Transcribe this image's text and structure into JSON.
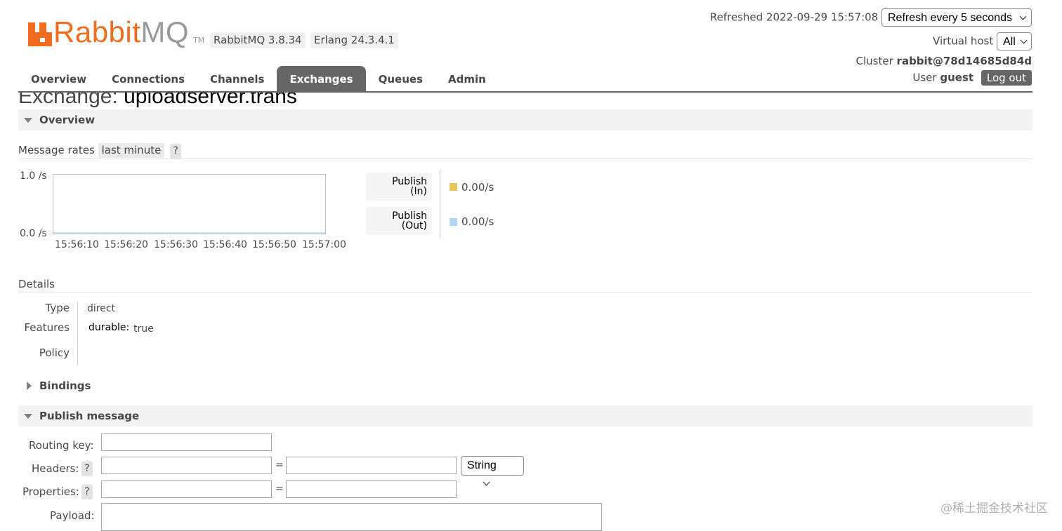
{
  "header": {
    "logo_main": "Rabbit",
    "logo_accent": "MQ",
    "logo_tm": "TM",
    "rabbitmq_version": "RabbitMQ 3.8.34",
    "erlang_version": "Erlang 24.3.4.1",
    "refreshed_label": "Refreshed 2022-09-29 15:57:08",
    "refresh_select": "Refresh every 5 seconds",
    "vhost_label": "Virtual host",
    "vhost_value": "All",
    "cluster_label": "Cluster",
    "cluster_name": "rabbit@78d14685d84d",
    "user_label": "User",
    "user_name": "guest",
    "logout": "Log out"
  },
  "tabs": [
    {
      "label": "Overview"
    },
    {
      "label": "Connections"
    },
    {
      "label": "Channels"
    },
    {
      "label": "Exchanges",
      "active": true
    },
    {
      "label": "Queues"
    },
    {
      "label": "Admin"
    }
  ],
  "page": {
    "title_prefix": "Exchange:",
    "title_name": "uploadserver.trans"
  },
  "overview": {
    "section_label": "Overview",
    "rates_label": "Message rates",
    "rates_range": "last minute",
    "help": "?",
    "chart": {
      "y_top": "1.0 /s",
      "y_bottom": "0.0 /s",
      "x_ticks": [
        "15:56:10",
        "15:56:20",
        "15:56:30",
        "15:56:40",
        "15:56:50",
        "15:57:00"
      ]
    },
    "rates": [
      {
        "line1": "Publish",
        "line2": "(In)",
        "value": "0.00/s",
        "color": "#e5c759"
      },
      {
        "line1": "Publish",
        "line2": "(Out)",
        "value": "0.00/s",
        "color": "#b4d6f2"
      }
    ]
  },
  "details": {
    "heading": "Details",
    "type_label": "Type",
    "type_value": "direct",
    "features_label": "Features",
    "durable_label": "durable:",
    "durable_value": "true",
    "policy_label": "Policy"
  },
  "bindings": {
    "section_label": "Bindings"
  },
  "publish": {
    "section_label": "Publish message",
    "routing_key_label": "Routing key:",
    "headers_label": "Headers:",
    "properties_label": "Properties:",
    "payload_label": "Payload:",
    "help": "?",
    "equals": "=",
    "header_type": "String"
  },
  "watermark": "@稀土掘金技术社区"
}
